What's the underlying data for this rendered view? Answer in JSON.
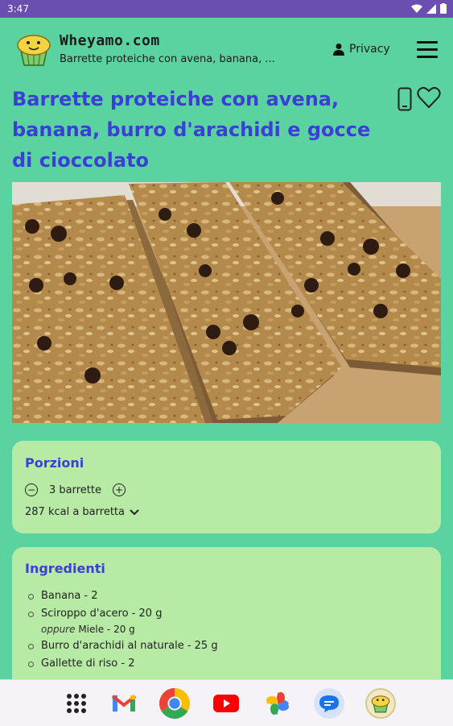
{
  "status": {
    "time": "3:47"
  },
  "header": {
    "site_title": "Wheyamo.com",
    "site_subtitle": "Barrette proteiche con avena, banana, ...",
    "privacy_label": "Privacy"
  },
  "recipe": {
    "title": "Barrette proteiche con avena, banana, burro d'arachidi e gocce di cioccolato"
  },
  "servings": {
    "heading": "Porzioni",
    "count": "3 barrette",
    "kcal": "287 kcal a barretta"
  },
  "ingredients": {
    "heading": "Ingredienti",
    "items": [
      "Banana - 2",
      "Sciroppo d'acero - 20 g",
      "Burro d'arachidi al naturale - 25 g",
      "Gallette di riso - 2"
    ],
    "alt": {
      "prefix": "oppure",
      "text": "Miele - 20 g"
    }
  },
  "icons": {
    "user": "person-icon",
    "menu": "hamburger-icon",
    "device": "phone-icon",
    "favorite": "heart-icon"
  },
  "colors": {
    "background": "#5bd3a0",
    "statusbar": "#6a4fb1",
    "title": "#3b3fd6",
    "card": "#b7eaa5"
  },
  "dock": [
    "apps-grid-icon",
    "gmail-icon",
    "chrome-icon",
    "youtube-icon",
    "photos-icon",
    "messages-icon",
    "wheyamo-app-icon"
  ]
}
